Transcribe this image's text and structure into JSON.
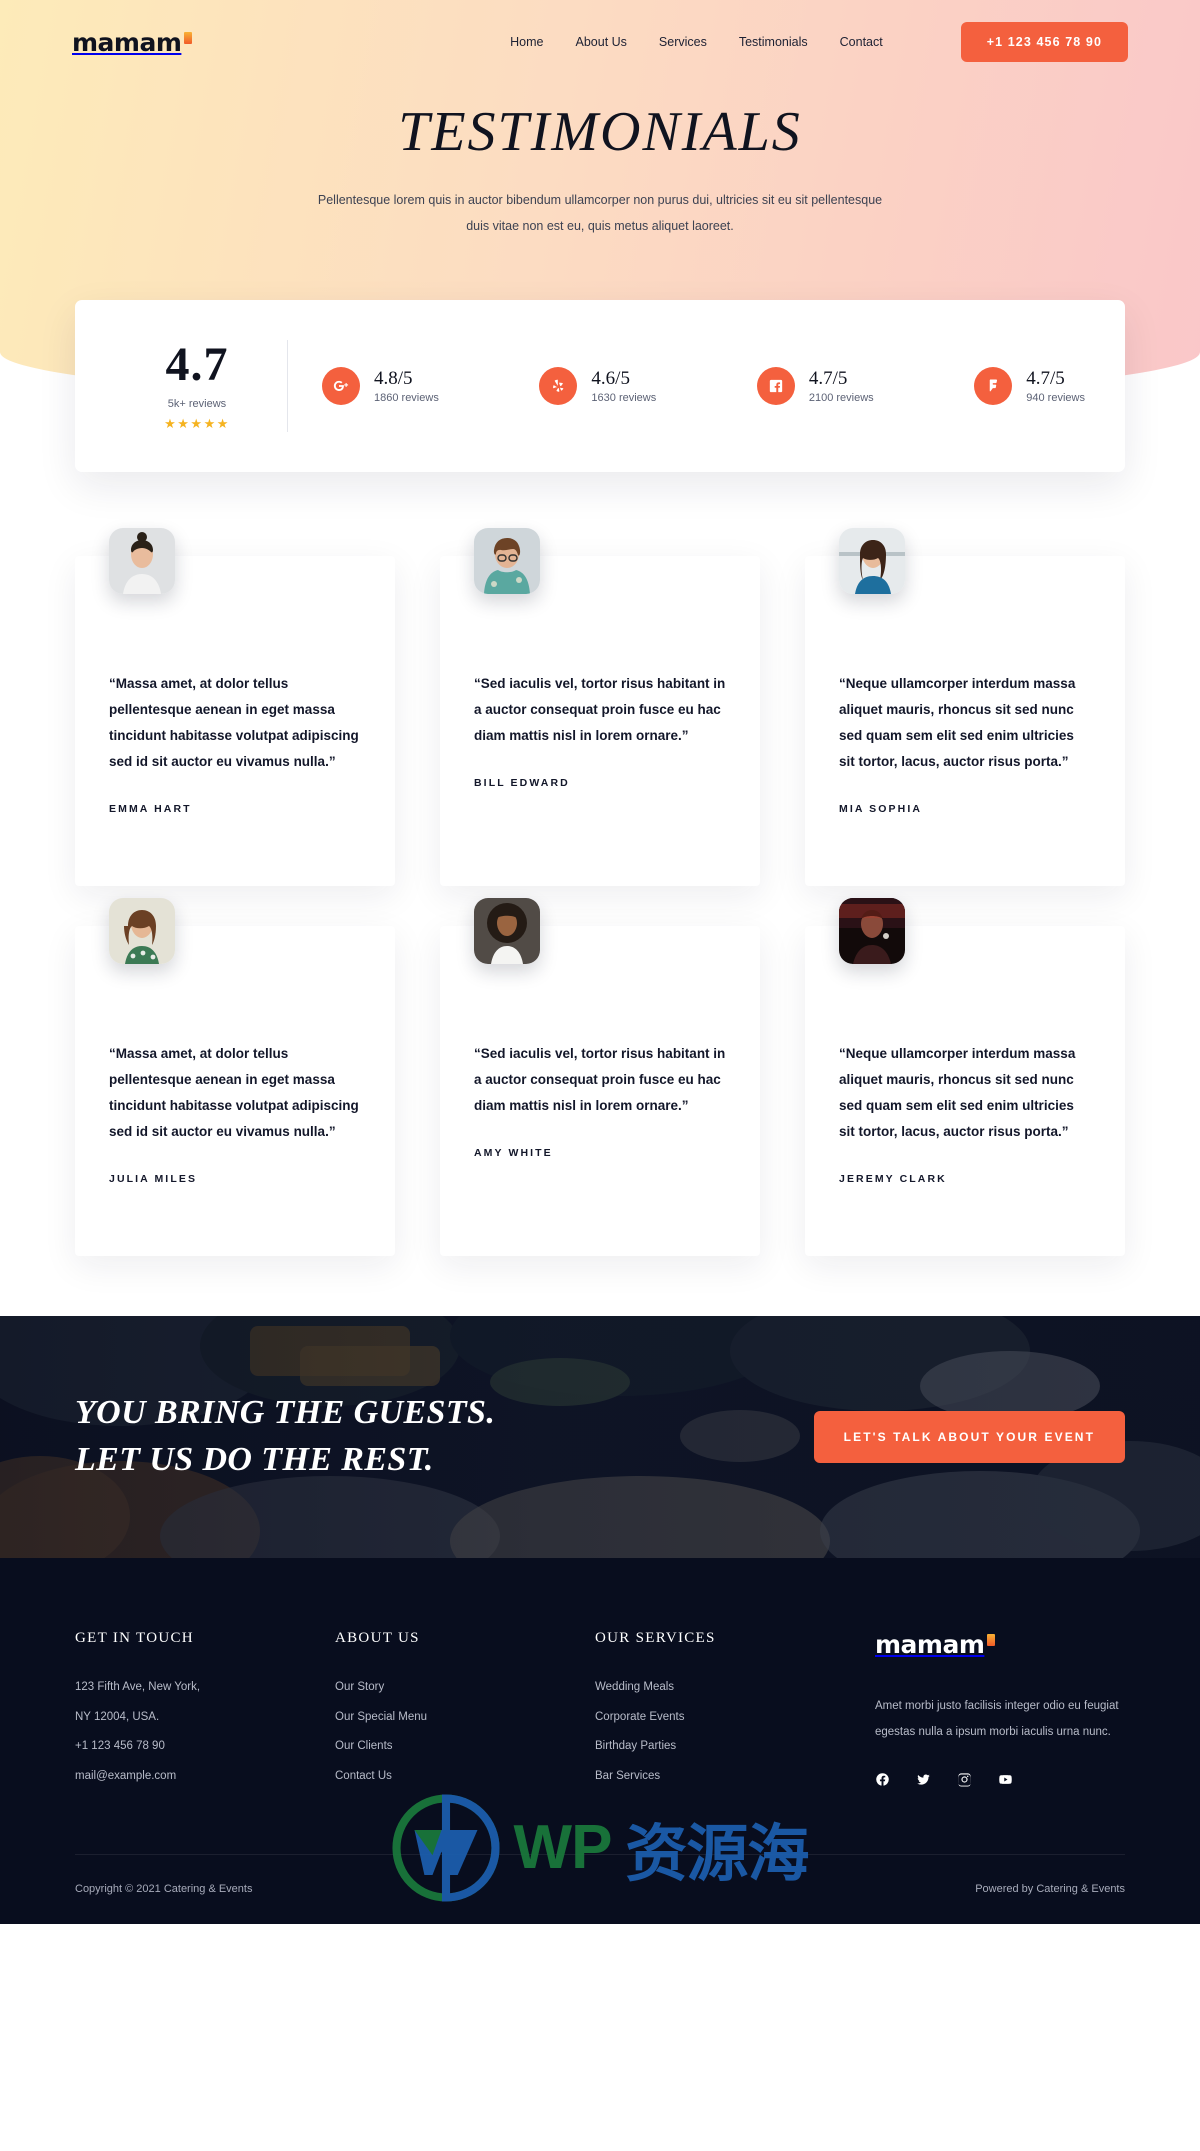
{
  "brand": {
    "name": "mamam",
    "mark": "flame-mark"
  },
  "nav": {
    "links": [
      {
        "label": "Home"
      },
      {
        "label": "About Us"
      },
      {
        "label": "Services"
      },
      {
        "label": "Testimonials"
      },
      {
        "label": "Contact"
      }
    ],
    "phone_label": "+1 123 456 78 90"
  },
  "hero": {
    "title": "TESTIMONIALS",
    "subtitle": "Pellentesque lorem quis in auctor bibendum ullamcorper non purus dui, ultricies sit eu sit pellentesque duis vitae non est eu, quis metus aliquet laoreet."
  },
  "stats": {
    "overall_score": "4.7",
    "overall_label": "5k+ reviews",
    "stars": "★★★★★",
    "sources": [
      {
        "icon": "google-plus-icon",
        "score": "4.8/5",
        "reviews": "1860 reviews"
      },
      {
        "icon": "yelp-icon",
        "score": "4.6/5",
        "reviews": "1630 reviews"
      },
      {
        "icon": "facebook-icon",
        "score": "4.7/5",
        "reviews": "2100 reviews"
      },
      {
        "icon": "foursquare-icon",
        "score": "4.7/5",
        "reviews": "940 reviews"
      }
    ]
  },
  "testimonials": [
    {
      "quote": "“Massa amet, at dolor tellus pellentesque aenean in eget massa tincidunt habitasse volutpat adipiscing sed id sit auctor eu vivamus nulla.”",
      "author": "EMMA HART"
    },
    {
      "quote": "“Sed iaculis vel, tortor risus habitant in a auctor consequat proin fusce eu hac diam mattis nisl in lorem ornare.”",
      "author": "BILL EDWARD"
    },
    {
      "quote": "“Neque ullamcorper interdum massa aliquet mauris, rhoncus sit sed nunc sed quam sem elit sed enim ultricies sit tortor, lacus, auctor risus porta.”",
      "author": "MIA SOPHIA"
    },
    {
      "quote": "“Massa amet, at dolor tellus pellentesque aenean in eget massa tincidunt habitasse volutpat adipiscing sed id sit auctor eu vivamus nulla.”",
      "author": "JULIA MILES"
    },
    {
      "quote": "“Sed iaculis vel, tortor risus habitant in a auctor consequat proin fusce eu hac diam mattis nisl in lorem ornare.”",
      "author": "AMY WHITE"
    },
    {
      "quote": "“Neque ullamcorper interdum massa aliquet mauris, rhoncus sit sed nunc sed quam sem elit sed enim ultricies sit tortor, lacus, auctor risus porta.”",
      "author": "JEREMY CLARK"
    }
  ],
  "cta": {
    "line1": "YOU BRING THE GUESTS.",
    "line2": "LET US DO THE REST.",
    "button": "LET'S TALK ABOUT YOUR EVENT"
  },
  "footer": {
    "contact": {
      "heading": "GET IN TOUCH",
      "address_line1": "123 Fifth Ave, New York,",
      "address_line2": "NY 12004, USA.",
      "phone": "+1 123 456 78 90",
      "email": "mail@example.com"
    },
    "about": {
      "heading": "ABOUT US",
      "links": [
        {
          "label": "Our Story"
        },
        {
          "label": "Our Special Menu"
        },
        {
          "label": "Our Clients"
        },
        {
          "label": "Contact Us"
        }
      ]
    },
    "services": {
      "heading": "OUR SERVICES",
      "links": [
        {
          "label": "Wedding Meals"
        },
        {
          "label": "Corporate Events"
        },
        {
          "label": "Birthday Parties"
        },
        {
          "label": "Bar Services"
        }
      ]
    },
    "brand_blurb": "Amet morbi justo facilisis integer odio eu feugiat egestas nulla a ipsum morbi iaculis urna nunc.",
    "socials": [
      {
        "icon": "facebook-icon"
      },
      {
        "icon": "twitter-icon"
      },
      {
        "icon": "instagram-icon"
      },
      {
        "icon": "youtube-icon"
      }
    ],
    "copyright": "Copyright © 2021 Catering & Events",
    "powered_by": "Powered by Catering & Events"
  },
  "watermark": {
    "wp": "WP",
    "cn": "资源海"
  },
  "colors": {
    "accent": "#f4603e",
    "footer_bg": "#080d1e",
    "star": "#f5b320"
  }
}
